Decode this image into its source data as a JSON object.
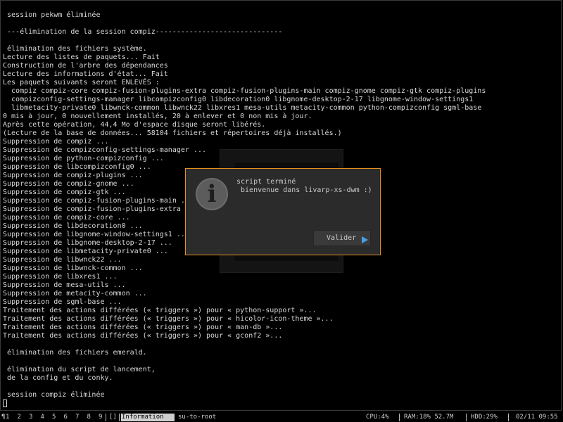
{
  "terminal": {
    "lines": [
      " session pekwm éliminée",
      "",
      " ---élimination de la session compiz------------------------------",
      "",
      " élimination des fichiers système.",
      "Lecture des listes de paquets... Fait",
      "Construction de l'arbre des dépendances",
      "Lecture des informations d'état... Fait",
      "Les paquets suivants seront ENLEVÉS :",
      "  compiz compiz-core compiz-fusion-plugins-extra compiz-fusion-plugins-main compiz-gnome compiz-gtk compiz-plugins",
      "  compizconfig-settings-manager libcompizconfig0 libdecoration0 libgnome-desktop-2-17 libgnome-window-settings1",
      "  libmetacity-private0 libwnck-common libwnck22 libxres1 mesa-utils metacity-common python-compizconfig sgml-base",
      "0 mis à jour, 0 nouvellement installés, 20 à enlever et 0 non mis à jour.",
      "Après cette opération, 44,4 Mo d'espace disque seront libérés.",
      "(Lecture de la base de données... 58104 fichiers et répertoires déjà installés.)",
      "Suppression de compiz ...",
      "Suppression de compizconfig-settings-manager ...",
      "Suppression de python-compizconfig ...",
      "Suppression de libcompizconfig0 ...",
      "Suppression de compiz-plugins ...",
      "Suppression de compiz-gnome ...",
      "Suppression de compiz-gtk ...",
      "Suppression de compiz-fusion-plugins-main ...",
      "Suppression de compiz-fusion-plugins-extra ...",
      "Suppression de compiz-core ...",
      "Suppression de libdecoration0 ...",
      "Suppression de libgnome-window-settings1 ...",
      "Suppression de libgnome-desktop-2-17 ...",
      "Suppression de libmetacity-private0 ...",
      "Suppression de libwnck22 ...",
      "Suppression de libwnck-common ...",
      "Suppression de libxres1 ...",
      "Suppression de mesa-utils ...",
      "Suppression de metacity-common ...",
      "Suppression de sgml-base ...",
      "Traitement des actions différées (« triggers ») pour « python-support »...",
      "Traitement des actions différées (« triggers ») pour « hicolor-icon-theme »...",
      "Traitement des actions différées (« triggers ») pour « man-db »...",
      "Traitement des actions différées (« triggers ») pour « gconf2 »...",
      "",
      " élimination des fichiers emerald.",
      "",
      " élimination du script de lancement,",
      " de la config et du conky.",
      "",
      " session compiz éliminée"
    ]
  },
  "dialog": {
    "icon": "info-icon",
    "line1": "script terminé",
    "line2": " bienvenue dans livarp-xs-dwm :)",
    "ok_label": "Valider",
    "border_color": "#e8901c"
  },
  "statusbar": {
    "layout_symbol": "¶",
    "workspaces": [
      "1",
      "2",
      "3",
      "4",
      "5",
      "6",
      "7",
      "8",
      "9"
    ],
    "layout": "[]",
    "active_window": "Information",
    "other_window": "su-to-root",
    "cpu": "CPU:4%",
    "ram": "RAM:18% 52.7M",
    "hdd": "HDD:29%",
    "datetime": "02/11 09:55"
  }
}
